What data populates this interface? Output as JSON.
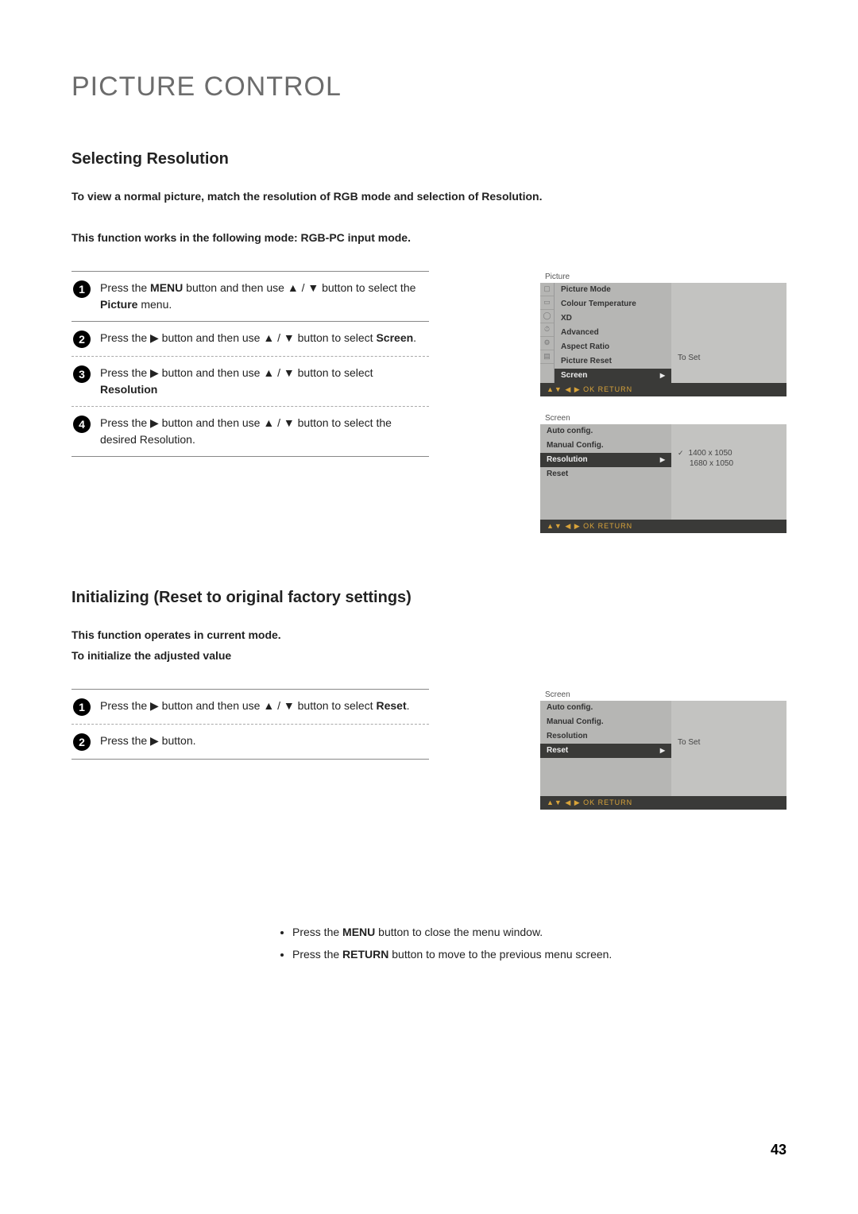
{
  "page_title": "PICTURE CONTROL",
  "page_number": "43",
  "section1": {
    "title": "Selecting Resolution",
    "intro_line1": "To view a normal picture, match the resolution of RGB mode and selection of Resolution.",
    "intro_line2": "This function works in the following mode: RGB-PC input mode.",
    "steps": {
      "s1a": "Press the ",
      "s1b": "MENU",
      "s1c": " button and then use ▲ / ▼ button to select the ",
      "s1d": "Picture",
      "s1e": " menu.",
      "s2a": "Press the ▶ button and then use ▲ / ▼ button to select ",
      "s2b": "Screen",
      "s2c": ".",
      "s3a": "Press the ▶ button and then use ▲ / ▼ button to select ",
      "s3b": "Resolution",
      "s4a": "Press the ▶ button and then use ▲ / ▼ button to select the desired Resolution."
    }
  },
  "osd1": {
    "title": "Picture",
    "items": [
      "Picture Mode",
      "Colour Temperature",
      "XD",
      "Advanced",
      "Aspect Ratio",
      "Picture Reset",
      "Screen"
    ],
    "selected_value": "To Set",
    "footer": "▲▼  ◀ ▶  OK  RETURN"
  },
  "osd2": {
    "title": "Screen",
    "items": [
      "Auto config.",
      "Manual Config.",
      "Resolution",
      "Reset"
    ],
    "values": [
      "1400 x 1050",
      "1680 x 1050"
    ],
    "footer": "▲▼  ◀ ▶  OK  RETURN"
  },
  "section2": {
    "title": "Initializing (Reset to original factory settings)",
    "intro_line1": "This function operates in current mode.",
    "intro_line2": "To initialize the adjusted value",
    "steps": {
      "s1a": "Press the ▶ button and then use ▲ / ▼  button to select ",
      "s1b": "Reset",
      "s1c": ".",
      "s2a": "Press the ▶ button."
    }
  },
  "osd3": {
    "title": "Screen",
    "items": [
      "Auto config.",
      "Manual Config.",
      "Resolution",
      "Reset"
    ],
    "selected_value": "To Set",
    "footer": "▲▼  ◀ ▶  OK  RETURN"
  },
  "notes": {
    "n1a": "Press the ",
    "n1b": "MENU",
    "n1c": " button to close the menu window.",
    "n2a": "Press the ",
    "n2b": "RETURN",
    "n2c": " button to move to the previous menu screen."
  }
}
